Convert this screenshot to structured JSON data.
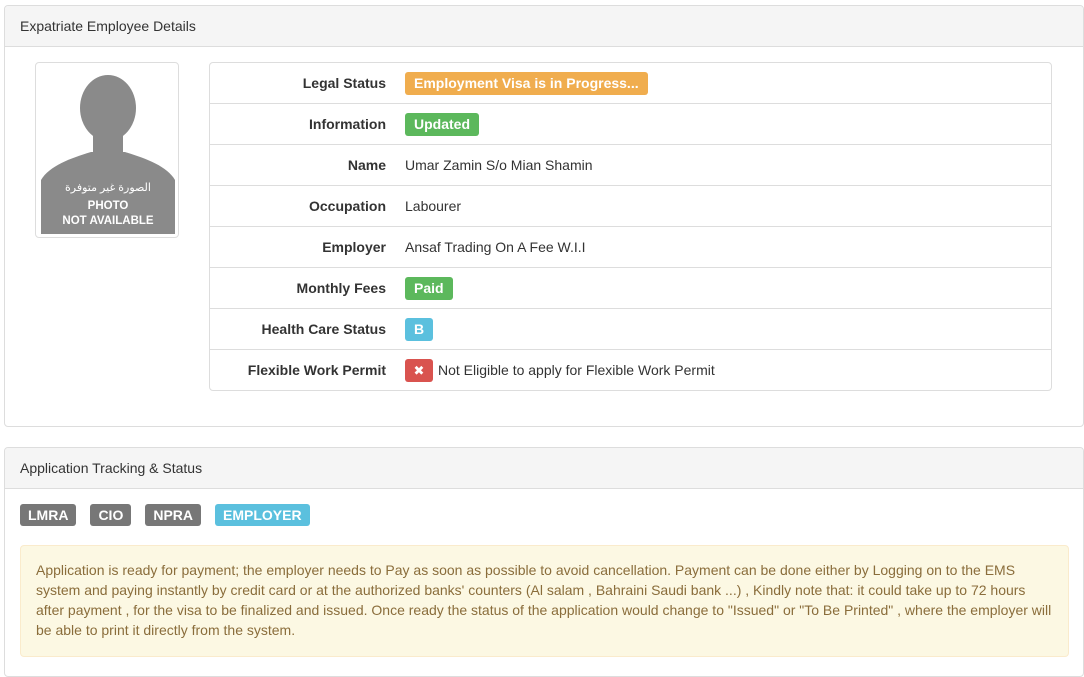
{
  "employee_panel": {
    "title": "Expatriate Employee Details",
    "photo": {
      "arabic_text": "الصورة غير متوفرة",
      "line1": "PHOTO",
      "line2": "NOT AVAILABLE"
    },
    "rows": [
      {
        "label": "Legal Status",
        "value": "Employment Visa is in Progress...",
        "badge": "warning"
      },
      {
        "label": "Information",
        "value": "Updated",
        "badge": "success"
      },
      {
        "label": "Name",
        "value": "Umar Zamin S/o Mian Shamin"
      },
      {
        "label": "Occupation",
        "value": "Labourer"
      },
      {
        "label": "Employer",
        "value": "Ansaf Trading On A Fee W.I.I"
      },
      {
        "label": "Monthly Fees",
        "value": "Paid",
        "badge": "success"
      },
      {
        "label": "Health Care Status",
        "value": "B",
        "badge": "info"
      },
      {
        "label": "Flexible Work Permit",
        "value": "Not Eligible to apply for Flexible Work Permit",
        "icon": "close-icon",
        "icon_glyph": "✖"
      }
    ]
  },
  "tracking_panel": {
    "title": "Application Tracking & Status",
    "tags": [
      {
        "label": "LMRA",
        "active": false
      },
      {
        "label": "CIO",
        "active": false
      },
      {
        "label": "NPRA",
        "active": false
      },
      {
        "label": "EMPLOYER",
        "active": true
      }
    ],
    "message": "Application is ready for payment; the employer needs to Pay as soon as possible to avoid cancellation. Payment can be done either by Logging on to the EMS system and paying instantly by credit card or at the authorized banks' counters (Al salam , Bahraini Saudi bank ...) , Kindly note that: it could take up to 72 hours after payment , for the visa to be finalized and issued. Once ready the status of the application would change to \"Issued\" or \"To Be Printed\" , where the employer will be able to print it directly from the system."
  },
  "colors": {
    "warning": "#f0ad4e",
    "success": "#5cb85c",
    "info": "#5bc0de",
    "danger": "#d9534f",
    "default_tag": "#777777",
    "alert_bg": "#fcf8e3",
    "alert_text": "#8a6d3b"
  }
}
